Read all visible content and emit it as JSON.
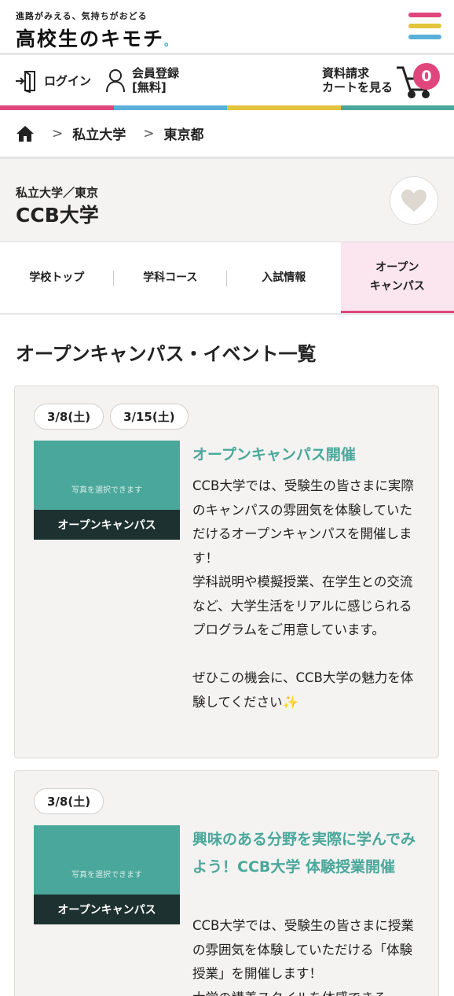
{
  "header": {
    "tagline": "進路がみえる、気持ちがおどる",
    "logo_text": "高校生のキモチ",
    "logo_dot": "。",
    "menu_colors": [
      "#e0467c",
      "#e3c43d",
      "#5ab0d8"
    ]
  },
  "utility": {
    "login": "ログイン",
    "register_line1": "会員登録",
    "register_line2": "[無料]",
    "request_line1": "資料請求",
    "request_line2": "カートを見る",
    "cart_count": "0"
  },
  "stripe_colors": [
    "#e0467c",
    "#5ab0d8",
    "#e3c43d",
    "#4aa79b"
  ],
  "breadcrumb": {
    "items": [
      "私立大学",
      "東京都"
    ]
  },
  "school": {
    "subtitle": "私立大学／東京",
    "name": "CCB大学"
  },
  "tabs": [
    {
      "label": "学校トップ"
    },
    {
      "label": "学科コース"
    },
    {
      "label": "入試情報"
    },
    {
      "label_line1": "オープン",
      "label_line2": "キャンパス"
    }
  ],
  "section_title": "オープンキャンパス・イベント一覧",
  "events": [
    {
      "dates": [
        "3/8(土)",
        "3/15(土)"
      ],
      "photo_placeholder": "写真を選択できます",
      "photo_label": "オープンキャンパス",
      "title": "オープンキャンパス開催",
      "body": "CCB大学では、受験生の皆さまに実際のキャンパスの雰囲気を体験していただけるオープンキャンパスを開催します！\n学科説明や模擬授業、在学生との交流など、大学生活をリアルに感じられるプログラムをご用意しています。\n\nぜひこの機会に、CCB大学の魅力を体験してください✨"
    },
    {
      "dates": [
        "3/8(土)"
      ],
      "photo_placeholder": "写真を選択できます",
      "photo_label": "オープンキャンパス",
      "title": "興味のある分野を実際に学んでみよう！CCB大学 体験授業開催",
      "body": "CCB大学では、受験生の皆さまに授業の雰囲気を体験していただける「体験授業」を開催します！\n大学の講義スタイルを体感できる"
    }
  ]
}
